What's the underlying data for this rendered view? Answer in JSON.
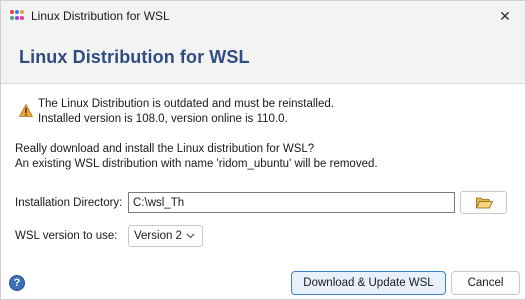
{
  "window": {
    "title": "Linux Distribution for WSL",
    "close_glyph": "✕"
  },
  "header": {
    "title": "Linux Distribution for WSL"
  },
  "warning": {
    "icon": "warning-icon",
    "line1": "The Linux Distribution is outdated and must be reinstalled.",
    "line2": "Installed version is 108.0, version online is 110.0."
  },
  "question": {
    "line1": "Really download and install the Linux distribution for WSL?",
    "line2": "An existing WSL distribution with name 'ridom_ubuntu' will be removed."
  },
  "form": {
    "dir_label": "Installation Directory:",
    "dir_value": "C:\\wsl_Th",
    "browse_icon": "folder-open-icon",
    "version_label": "WSL version to use:",
    "version_value": "Version 2"
  },
  "footer": {
    "help_glyph": "?",
    "primary_label": "Download & Update WSL",
    "cancel_label": "Cancel"
  },
  "colors": {
    "header_title": "#2f4d80",
    "accent_border": "#3f7fc9",
    "help_icon": "#3d6fb6",
    "warning_fill": "#e8a33d"
  }
}
